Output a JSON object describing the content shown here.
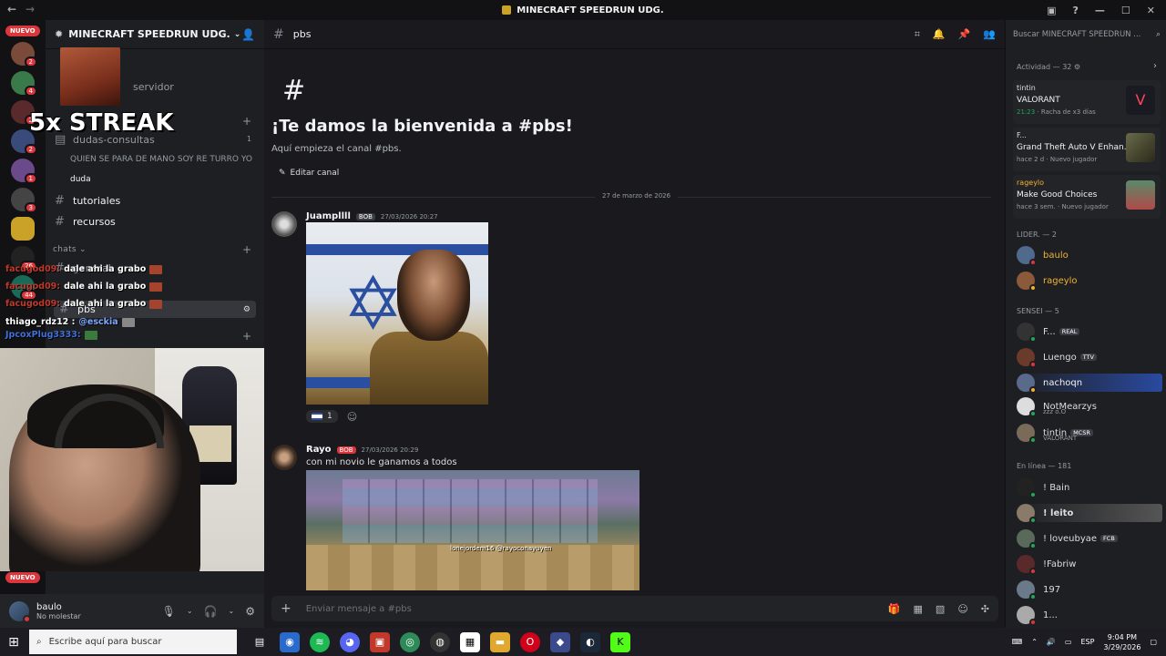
{
  "window": {
    "title": "MINECRAFT SPEEDRUN UDG."
  },
  "guilds": {
    "nuevo_label": "NUEVO",
    "badges": [
      "2",
      "4",
      "2",
      "2",
      "1",
      "3",
      "26",
      "44"
    ]
  },
  "sidebar": {
    "server_name": "MINECRAFT SPEEDRUN UDG.",
    "item_servidor": "servidor",
    "channels": [
      {
        "name": "dudas-consultas",
        "count": "1"
      },
      {
        "name": "QUIEN SE PARA DE MANO SOY RE TURRO YO"
      },
      {
        "name": "duda"
      },
      {
        "name": "tutoriales"
      },
      {
        "name": "recursos"
      }
    ],
    "category_chats": "chats",
    "chats_channels": [
      {
        "name": "general"
      },
      {
        "name": "pbs"
      }
    ]
  },
  "overlay": {
    "streak": "5x STREAK",
    "chat": [
      {
        "user": "facugod09:",
        "text": "dale ahi la grabo"
      },
      {
        "user": "facugod09:",
        "text": "dale ahi la grabo"
      },
      {
        "user": "facugod09:",
        "text": "dale ahi la grabo"
      },
      {
        "user": "thiago_rdz12 :",
        "text": "@esckia"
      },
      {
        "user": "JpcoxPlug3333:",
        "text": ""
      }
    ]
  },
  "user_panel": {
    "name": "baulo",
    "status": "No molestar"
  },
  "channel_header": {
    "name": "pbs"
  },
  "welcome": {
    "hash": "#",
    "title": "¡Te damos la bienvenida a #pbs!",
    "subtitle": "Aquí empieza el canal #pbs.",
    "edit_label": "Editar canal"
  },
  "date_divider": "27 de marzo de 2026",
  "messages": [
    {
      "author": "Juampllll",
      "tag": "BOB",
      "time": "27/03/2026 20:27",
      "reaction_count": "1"
    },
    {
      "author": "Rayo",
      "tag": "BOB",
      "time": "27/03/2026 20:29",
      "text": "con mi novio le ganamos a todos",
      "image_caption": "lonejordem16  @rayoconayuyen"
    }
  ],
  "composer": {
    "placeholder": "Enviar mensaje a #pbs"
  },
  "members": {
    "search_placeholder": "Buscar MINECRAFT SPEEDRUN ...",
    "activity_header": "Actividad — 32",
    "activities": [
      {
        "user": "tintin",
        "game": "VALORANT",
        "time": "21:23",
        "note": "Racha de x3 días"
      },
      {
        "user": "F...",
        "game": "Grand Theft Auto V Enhan...",
        "time": "hace 2 d",
        "note": "Nuevo jugador"
      },
      {
        "user": "rageylo",
        "game": "Make Good Choices",
        "time": "hace 3 sem.",
        "note": "Nuevo jugador"
      }
    ],
    "lider_header": "LIDER. — 2",
    "lideres": [
      "baulo",
      "rageylo"
    ],
    "sensei_header": "SENSEI — 5",
    "senseis": [
      {
        "name": "F...",
        "tag": "REAL",
        "sub": ""
      },
      {
        "name": "Luengo",
        "tag": "TTV",
        "sub": ""
      },
      {
        "name": "nachoqn",
        "tag": "",
        "sub": ""
      },
      {
        "name": "NotMearzys",
        "tag": "",
        "sub": "zzz o.O"
      },
      {
        "name": "tintin",
        "tag": "MCSR",
        "sub": "VALORANT"
      }
    ],
    "online_header": "En línea — 181",
    "online": [
      {
        "name": "! Bain",
        "tag": ""
      },
      {
        "name": "! leito",
        "tag": ""
      },
      {
        "name": "! loveubyae",
        "tag": "FCB"
      },
      {
        "name": "!Fabriw",
        "tag": ""
      },
      {
        "name": "197",
        "tag": ""
      },
      {
        "name": "1...",
        "tag": ""
      }
    ]
  },
  "taskbar": {
    "search_placeholder": "Escribe aquí para buscar",
    "lang": "ESP",
    "time": "9:04 PM",
    "date": "3/29/2026"
  }
}
